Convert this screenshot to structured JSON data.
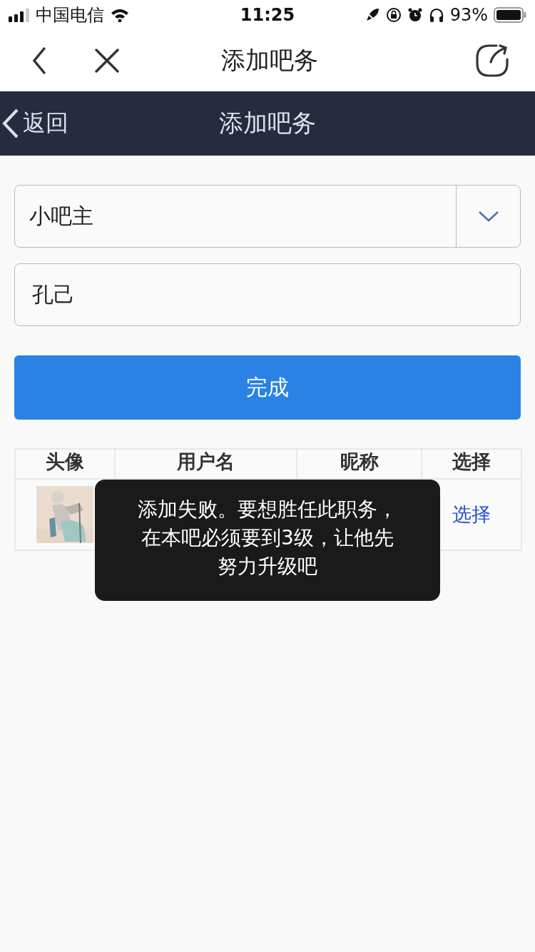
{
  "status_bar": {
    "carrier": "中国电信",
    "time": "11:25",
    "battery": "93%"
  },
  "nav_bar": {
    "title": "添加吧务"
  },
  "header": {
    "back": "返回",
    "title": "添加吧务"
  },
  "form": {
    "role": {
      "value": "小吧主"
    },
    "name": {
      "value": "孔己"
    },
    "submit": "完成"
  },
  "table": {
    "columns": [
      "头像",
      "用户名",
      "昵称",
      "选择"
    ],
    "rows": [
      {
        "action": "选择"
      }
    ]
  },
  "toast": {
    "message": "添加失败。要想胜任此职务，在本吧必须要到3级，让他先努力升级吧"
  }
}
